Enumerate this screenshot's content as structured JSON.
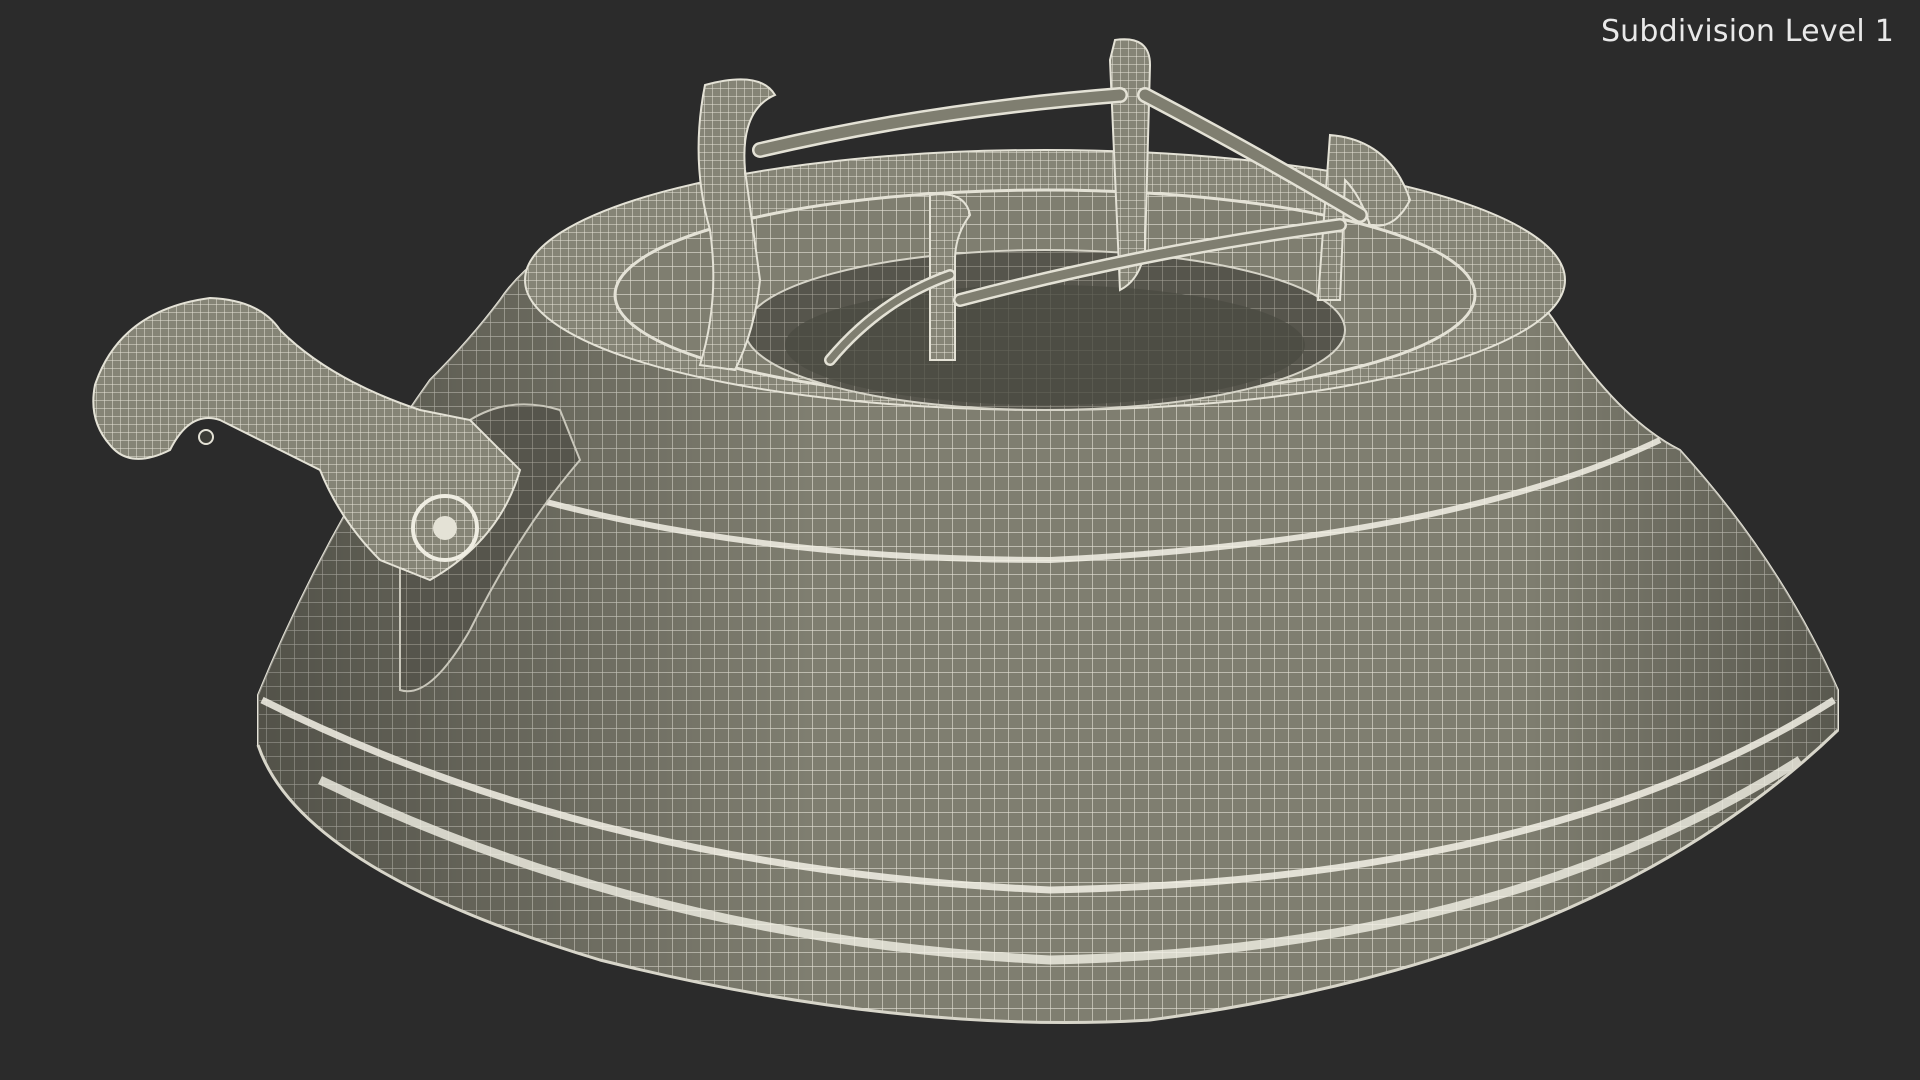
{
  "viewport": {
    "label": "Subdivision Level 1",
    "background_color": "#2b2b2b",
    "mesh_fill_color": "#7f7e70",
    "mesh_wire_color": "#e4e2d6"
  }
}
